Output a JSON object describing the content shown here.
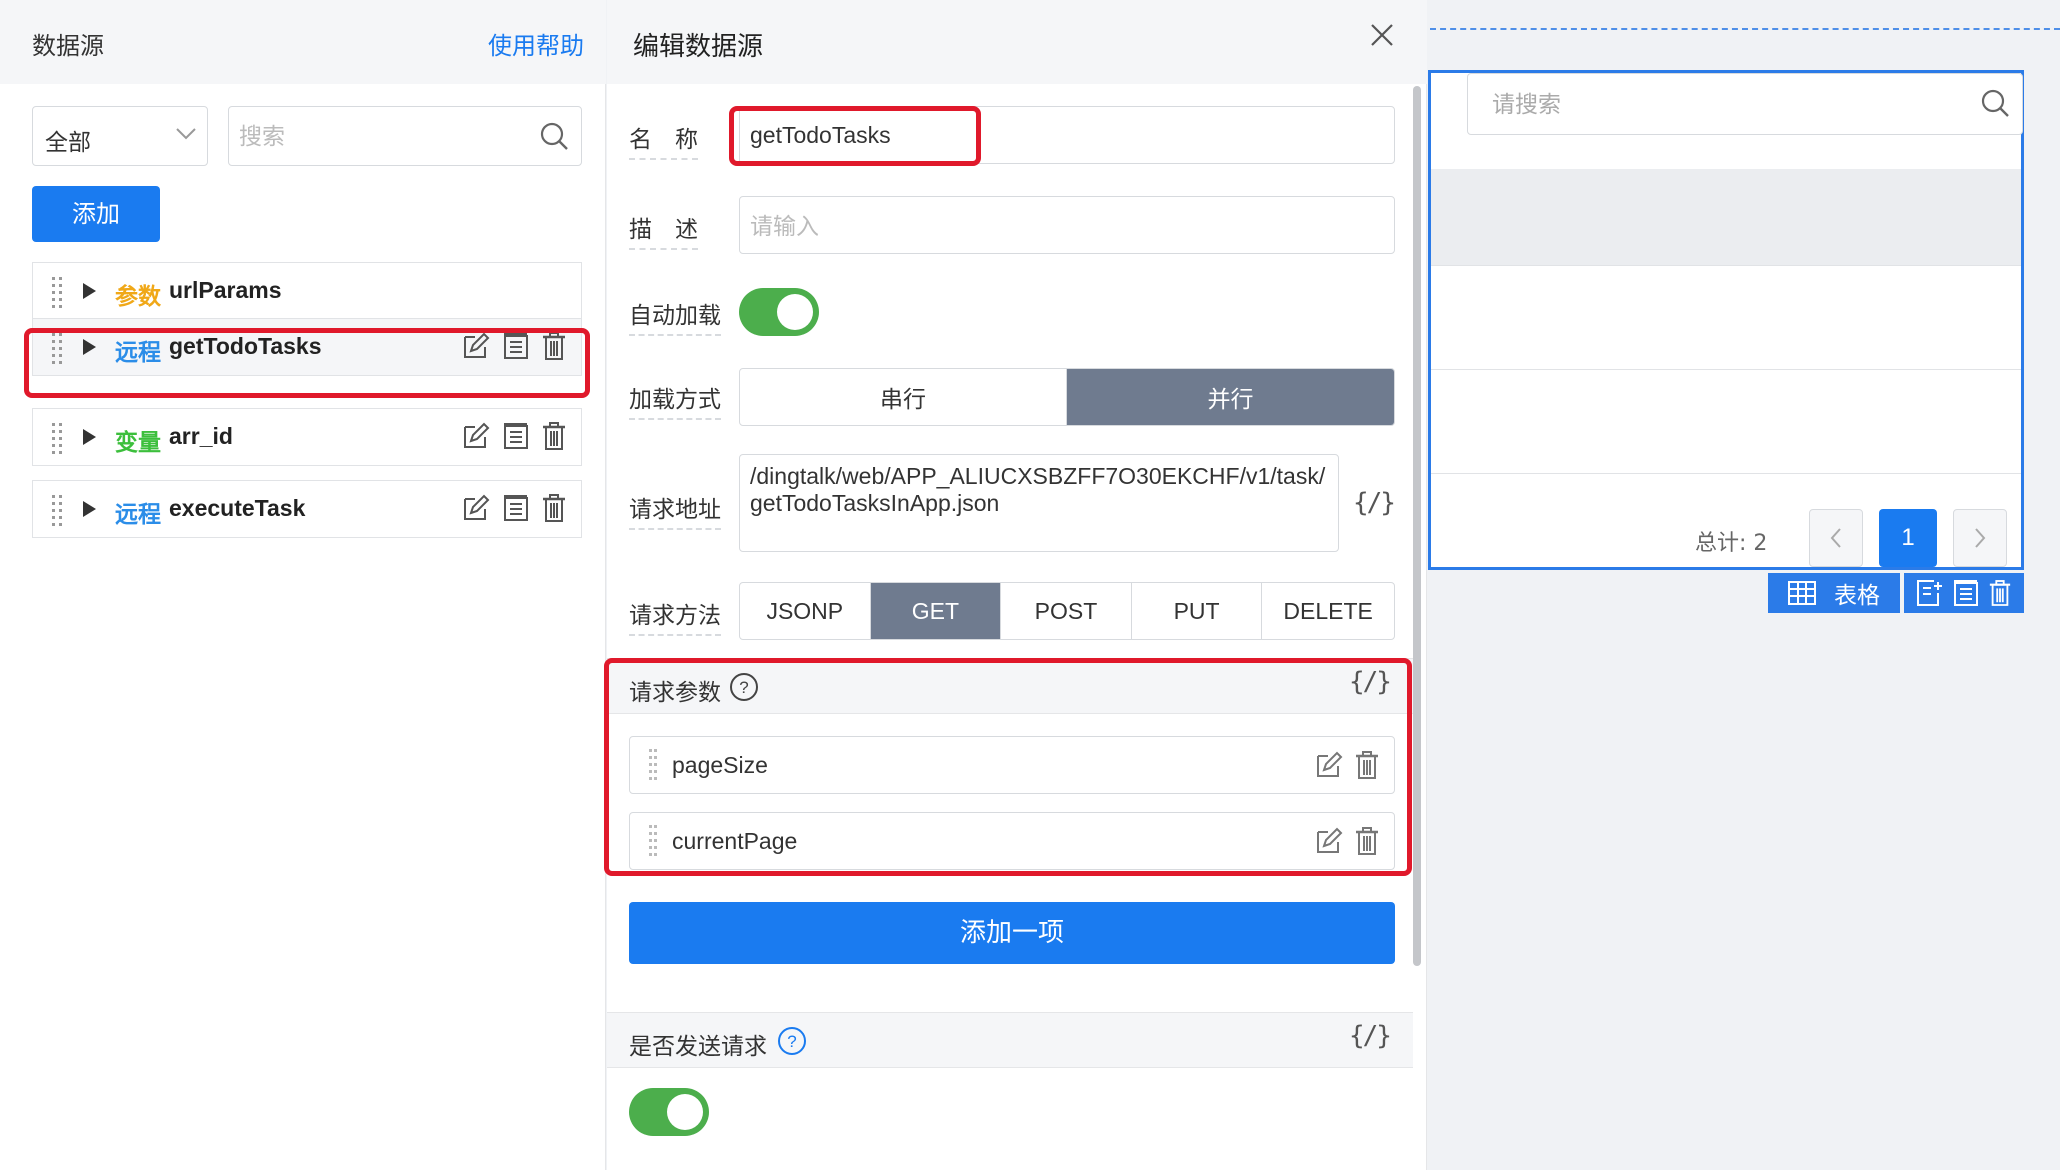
{
  "left_panel": {
    "title": "数据源",
    "help_link": "使用帮助",
    "filter": {
      "selected": "全部"
    },
    "search": {
      "placeholder": "搜索"
    },
    "add_button": "添加",
    "items": [
      {
        "kind": "参数",
        "kind_type": "param",
        "name": "urlParams",
        "has_ops": false
      },
      {
        "kind": "远程",
        "kind_type": "remote",
        "name": "getTodoTasks",
        "has_ops": true,
        "highlighted": true
      },
      {
        "kind": "变量",
        "kind_type": "var",
        "name": "arr_id",
        "has_ops": true
      },
      {
        "kind": "远程",
        "kind_type": "remote",
        "name": "executeTask",
        "has_ops": true
      }
    ]
  },
  "editor": {
    "title": "编辑数据源",
    "name": {
      "label": "名　称",
      "value": "getTodoTasks"
    },
    "description": {
      "label": "描　述",
      "placeholder": "请输入"
    },
    "auto_load": {
      "label": "自动加载",
      "on": true
    },
    "load_mode": {
      "label": "加载方式",
      "options": [
        "串行",
        "并行"
      ],
      "selected": "并行"
    },
    "request_url": {
      "label": "请求地址",
      "value": "/dingtalk/web/APP_ALIUCXSBZFF7O30EKCHF/v1/task/getTodoTasksInApp.json",
      "code_toggle": "{/}"
    },
    "request_method": {
      "label": "请求方法",
      "options": [
        "JSONP",
        "GET",
        "POST",
        "PUT",
        "DELETE"
      ],
      "selected": "GET"
    },
    "request_params": {
      "label": "请求参数",
      "code_toggle": "{/}",
      "items": [
        "pageSize",
        "currentPage"
      ]
    },
    "add_item_button": "添加一项",
    "send_request": {
      "label": "是否发送请求",
      "code_toggle": "{/}",
      "on": true
    }
  },
  "canvas": {
    "search_placeholder": "请搜索",
    "total_label": "总计: 2",
    "current_page": "1",
    "component_tag": "表格"
  },
  "colors": {
    "primary": "#1a7bf0",
    "highlight_border": "#e0192b",
    "toggle_on": "#4cae4c",
    "segment_active": "#6f7b8f",
    "kind_param": "#f0a818",
    "kind_remote": "#2b8de8",
    "kind_var": "#3cbf3c"
  }
}
